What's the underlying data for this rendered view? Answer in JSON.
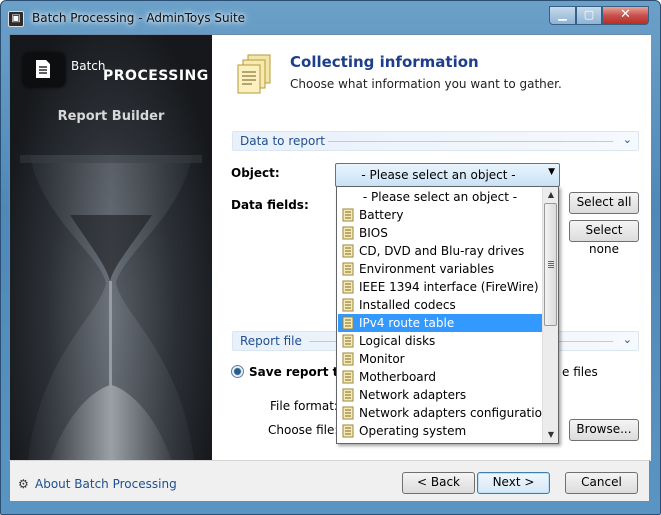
{
  "window": {
    "title": "Batch Processing - AdminToys Suite"
  },
  "brand": {
    "small": "Batch",
    "big": "Processing",
    "subtitle": "Report Builder"
  },
  "header": {
    "title": "Collecting information",
    "subtitle": "Choose what information you want to gather."
  },
  "sections": {
    "data_to_report": "Data to report",
    "report_file": "Report file"
  },
  "form": {
    "object_label": "Object:",
    "object_value": "- Please select an object -",
    "data_fields_label": "Data fields:",
    "select_all": "Select all",
    "select_none": "Select none",
    "save_report_label": "Save report to a",
    "files_suffix": "e files",
    "file_format_label": "File format:",
    "choose_file_label": "Choose file:",
    "browse": "Browse..."
  },
  "dropdown": {
    "items": [
      "- Please select an object -",
      "Battery",
      "BIOS",
      "CD, DVD and Blu-ray drives",
      "Environment variables",
      "IEEE 1394 interface (FireWire)",
      "Installed codecs",
      "IPv4 route table",
      "Logical disks",
      "Monitor",
      "Motherboard",
      "Network adapters",
      "Network adapters configuration",
      "Operating system"
    ],
    "selected": "IPv4 route table"
  },
  "footer": {
    "about": "About Batch Processing",
    "back": "< Back",
    "next": "Next >",
    "cancel": "Cancel"
  },
  "colors": {
    "accent": "#1e3e8a",
    "link": "#1e4f8e",
    "selection": "#3399ff"
  }
}
